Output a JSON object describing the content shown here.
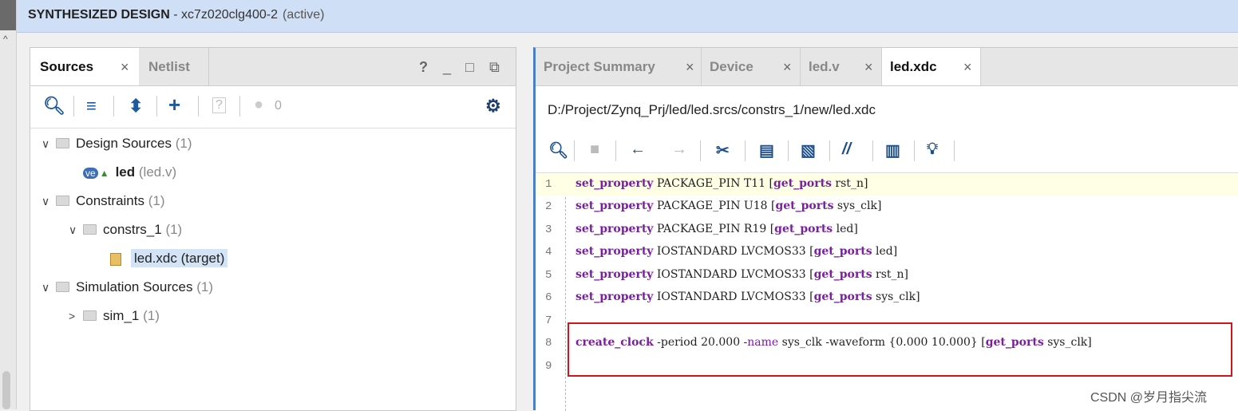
{
  "titlebar": {
    "title": "SYNTHESIZED DESIGN",
    "part": " - xc7z020clg400-2",
    "status": "(active)"
  },
  "left_panel": {
    "tabs": [
      {
        "label": "Sources",
        "close": "×"
      },
      {
        "label": "Netlist"
      }
    ],
    "window_buttons": [
      "?",
      "_",
      "□",
      "⧉"
    ],
    "toolbar": {
      "badge_count": "0"
    },
    "tree": [
      {
        "label": "Design Sources",
        "count": "(1)"
      },
      {
        "label": "led",
        "detail": "(led.v)"
      },
      {
        "label": "Constraints",
        "count": "(1)"
      },
      {
        "label": "constrs_1",
        "count": "(1)"
      },
      {
        "label": "led.xdc (target)"
      },
      {
        "label": "Simulation Sources",
        "count": "(1)"
      },
      {
        "label": "sim_1",
        "count": "(1)"
      }
    ]
  },
  "right_panel": {
    "tabs": [
      {
        "label": "Project Summary",
        "close": "×"
      },
      {
        "label": "Device",
        "close": "×"
      },
      {
        "label": "led.v",
        "close": "×"
      },
      {
        "label": "led.xdc",
        "close": "×"
      }
    ],
    "file_path": "D:/Project/Zynq_Prj/led/led.srcs/constrs_1/new/led.xdc",
    "code_lines": [
      {
        "n": "1",
        "kw": "set_property",
        "a": " PACKAGE_PIN T11 [",
        "cmd": "get_ports",
        "b": " rst_n]"
      },
      {
        "n": "2",
        "kw": "set_property",
        "a": " PACKAGE_PIN U18 [",
        "cmd": "get_ports",
        "b": " sys_clk]"
      },
      {
        "n": "3",
        "kw": "set_property",
        "a": " PACKAGE_PIN R19 [",
        "cmd": "get_ports",
        "b": " led]"
      },
      {
        "n": "4",
        "kw": "set_property",
        "a": " IOSTANDARD LVCMOS33 [",
        "cmd": "get_ports",
        "b": " led]"
      },
      {
        "n": "5",
        "kw": "set_property",
        "a": " IOSTANDARD LVCMOS33 [",
        "cmd": "get_ports",
        "b": " rst_n]"
      },
      {
        "n": "6",
        "kw": "set_property",
        "a": " IOSTANDARD LVCMOS33 [",
        "cmd": "get_ports",
        "b": " sys_clk]"
      },
      {
        "n": "7"
      },
      {
        "n": "8",
        "kw": "create_clock",
        "a": " -period 20.000 -",
        "name": "name",
        "c": " sys_clk -waveform {0.000 10.000} [",
        "cmd": "get_ports",
        "b": " sys_clk]"
      },
      {
        "n": "9"
      }
    ]
  },
  "watermark": "CSDN @岁月指尖流",
  "colors": {
    "keyword": "#7a1f9e",
    "highlight_box": "#d0151d",
    "active_border": "#4a7fc8"
  }
}
